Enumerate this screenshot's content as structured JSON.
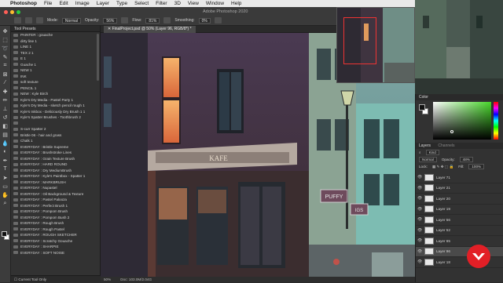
{
  "menubar": {
    "app": "Photoshop",
    "items": [
      "File",
      "Edit",
      "Image",
      "Layer",
      "Type",
      "Select",
      "Filter",
      "3D",
      "View",
      "Window",
      "Help"
    ],
    "right_icons": [
      "wifi-icon",
      "battery-icon",
      "search-icon",
      "menu-icon"
    ]
  },
  "window": {
    "title": "Adobe Photoshop 2020"
  },
  "options": {
    "mode_label": "Mode:",
    "mode_value": "Normal",
    "opacity_label": "Opacity:",
    "opacity_value": "56%",
    "flow_label": "Flow:",
    "flow_value": "81%",
    "smoothing_label": "Smoothing:",
    "smoothing_value": "0%"
  },
  "document_tab": {
    "label": "FinalProject.psd @ 50% (Layer 96, RGB/8*) *"
  },
  "presets": {
    "title": "Tool Presets",
    "items": [
      "PAINTER : gouache",
      "dirty line 1",
      "LINE 1",
      "TEX 2 1",
      "E 1",
      "Guache 1",
      "NEW 1",
      "INK",
      "soft texture",
      "PENCIL 1",
      "NEW : Kyle Birch",
      "Kyle's Dry Media - Pastel Party 1",
      "Kyle's Dry Media - sketch pencil rough 1",
      "Kyle's Inkbox - Deliciously Dry Brush 1 1",
      "Kyle's Spatter Brushes - Toothbrush 2",
      "",
      "S-curr Spatter 2",
      "Bristle 06 - hair and grass",
      "Chalk 1",
      "EVERYDAY : Bristle Supreme",
      "EVERYDAY : Brushstroke Lines",
      "EVERYDAY : Grain Texture Brush",
      "EVERYDAY : HARD ROUND",
      "EVERYDAY : Dry MediumBrush",
      "EVERYDAY : Kyle's Paintbox - Spatter 1",
      "EVERYDAY : MARKBRUSH",
      "EVERYDAY : Nupastel",
      "EVERYDAY : Oil Background & Texture",
      "EVERYDAY : Pastel Palooza",
      "EVERYDAY : Perfect Brush 1",
      "EVERYDAY : Pompom Brush",
      "EVERYDAY : Pompom Bush 2",
      "EVERYDAY : Rough Brush",
      "EVERYDAY : Rough Pastel",
      "EVERYDAY : ROUGH SKETCHER",
      "EVERYDAY : Scratchy Gouache",
      "EVERYDAY : SHARPIE",
      "EVERYDAY : SOFT NOISE"
    ],
    "footer": "Current Tool Only"
  },
  "status": {
    "zoom": "50%",
    "doc": "Doc: 103.0M/2.04G"
  },
  "color_panel": {
    "title": "Color",
    "accent": "#47d62a"
  },
  "layers_panel": {
    "tabs": [
      "Layers",
      "Channels"
    ],
    "kind_label": "Kind",
    "blend_mode": "Normal",
    "opacity_label": "Opacity:",
    "opacity_value": "48%",
    "lock_label": "Lock:",
    "fill_label": "Fill:",
    "fill_value": "100%",
    "layers": [
      "Layer 71",
      "Layer 21",
      "Layer 20",
      "Layer 19",
      "Layer 56",
      "Layer 52",
      "Layer 65",
      "Layer 96",
      "Layer 18"
    ]
  },
  "artwork": {
    "sign_text": "KAFE",
    "puffy_sign": "PUFFY",
    "pigs_sign": "IGS"
  }
}
